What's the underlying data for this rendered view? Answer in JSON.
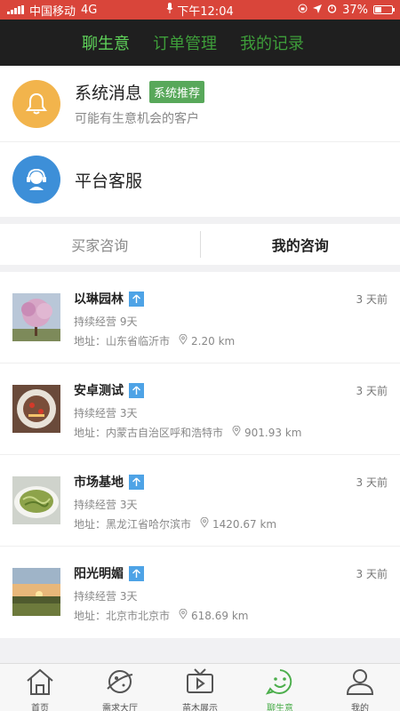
{
  "status_bar": {
    "carrier": "中国移动",
    "network": "4G",
    "time": "下午12:04",
    "battery": "37%",
    "battery_level": 0.37
  },
  "header": {
    "tabs": [
      {
        "label": "聊生意",
        "active": true
      },
      {
        "label": "订单管理",
        "active": false
      },
      {
        "label": "我的记录",
        "active": false
      }
    ]
  },
  "message_card": {
    "title": "系统消息",
    "badge": "系统推荐",
    "subtitle": "可能有生意机会的客户",
    "icon": "bell-icon"
  },
  "service_card": {
    "title": "平台客服",
    "icon": "customer-service-icon"
  },
  "segment": {
    "tabs": [
      {
        "label": "买家咨询",
        "active": false
      },
      {
        "label": "我的咨询",
        "active": true
      }
    ]
  },
  "list": {
    "address_prefix": "地址：",
    "items": [
      {
        "name": "以琳园林",
        "time": "3 天前",
        "duration": "持续经营 9天",
        "address": "山东省临沂市",
        "distance": "2.20 km",
        "thumb": "magnolia-tree"
      },
      {
        "name": "安卓测试",
        "time": "3 天前",
        "duration": "持续经营 3天",
        "address": "内蒙古自治区呼和浩特市",
        "distance": "901.93 km",
        "thumb": "cake"
      },
      {
        "name": "市场基地",
        "time": "3 天前",
        "duration": "持续经营 3天",
        "address": "黑龙江省哈尔滨市",
        "distance": "1420.67 km",
        "thumb": "noodles"
      },
      {
        "name": "阳光明媚",
        "time": "3 天前",
        "duration": "持续经营 3天",
        "address": "北京市北京市",
        "distance": "618.69 km",
        "thumb": "sunset"
      }
    ]
  },
  "bottom_nav": {
    "items": [
      {
        "label": "首页",
        "icon": "home-icon",
        "active": false
      },
      {
        "label": "需求大厅",
        "icon": "planet-icon",
        "active": false
      },
      {
        "label": "苗木展示",
        "icon": "tv-icon",
        "active": false
      },
      {
        "label": "聊生意",
        "icon": "smile-chat-icon",
        "active": true
      },
      {
        "label": "我的",
        "icon": "user-icon",
        "active": false
      }
    ]
  },
  "colors": {
    "status_bar": "#d9453a",
    "header_bg": "#1f1f1f",
    "header_active": "#5fd35a",
    "header_inactive": "#3e9e3a",
    "badge": "#58a85a",
    "bell": "#f2b44c",
    "service": "#3d8fd8",
    "up_tag": "#4ea3e6",
    "nav_active": "#4cae4c"
  }
}
